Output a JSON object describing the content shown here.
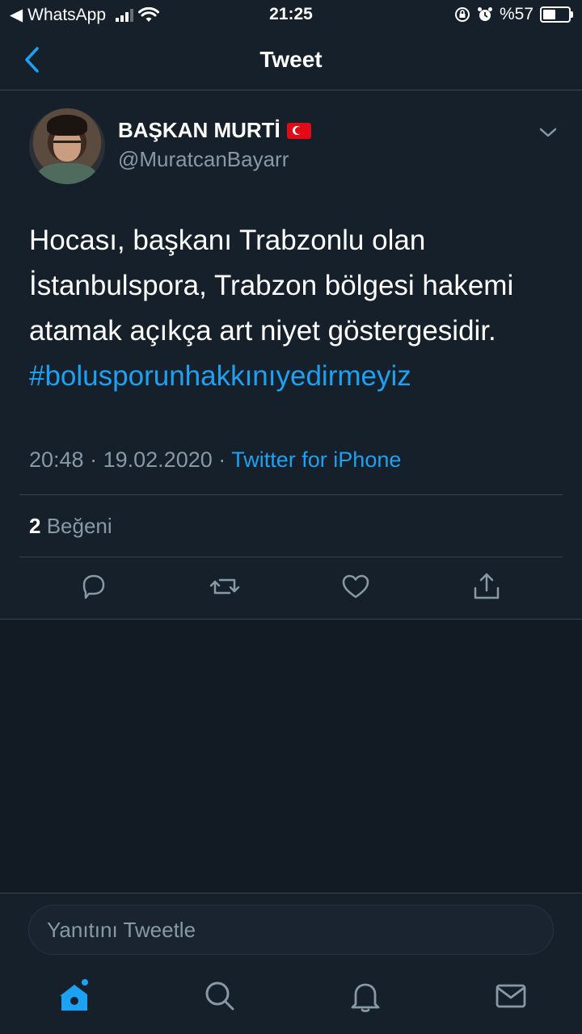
{
  "status_bar": {
    "back_app": "WhatsApp",
    "time": "21:25",
    "battery_text": "%57",
    "battery_level": 0.57
  },
  "nav": {
    "title": "Tweet",
    "back_icon": "chevron-left-icon"
  },
  "tweet": {
    "author_name": "BAŞKAN MURTİ",
    "author_handle": "@MuratcanBayarr",
    "text_lines": [
      "Hocası, başkanı Trabzonlu olan",
      "İstanbulspora, Trabzon bölgesi hakemi",
      "atamak açıkça art niyet göstergesidir."
    ],
    "hashtag": "#bolusporunhakkınıyedirmeyiz",
    "time": "20:48",
    "date": "19.02.2020",
    "separator": "·",
    "source": "Twitter for iPhone",
    "like_count": "2",
    "like_label": "Beğeni"
  },
  "reply": {
    "placeholder": "Yanıtını Tweetle"
  },
  "colors": {
    "background": "#15202b",
    "accent": "#1da1f2",
    "muted": "#8899a6",
    "border": "#38444d"
  }
}
